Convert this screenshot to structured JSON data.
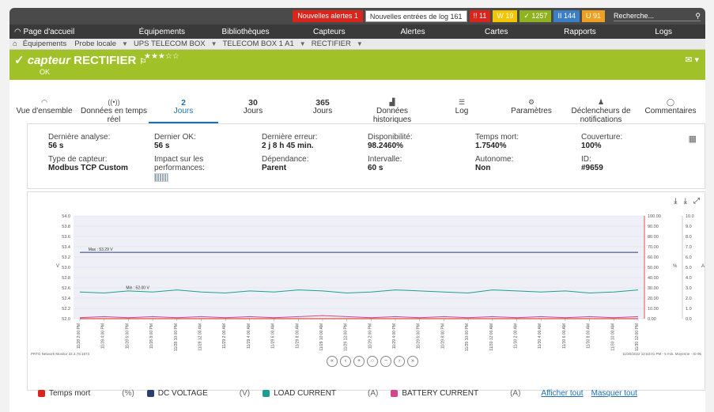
{
  "topbar": {
    "new_alerts_label": "Nouvelles alertes",
    "new_alerts_count": "1",
    "new_logs_label": "Nouvelles entrées de log",
    "new_logs_count": "161",
    "badges": [
      {
        "text": "!! 11",
        "color": "#d9251c"
      },
      {
        "text": "W 19",
        "color": "#f2c500"
      },
      {
        "text": "✓ 1257",
        "color": "#8fb31f"
      },
      {
        "text": "II 144",
        "color": "#3d7fc4"
      },
      {
        "text": "U 91",
        "color": "#f0a020"
      }
    ],
    "search_placeholder": "Recherche..."
  },
  "nav": [
    "Page d'accueil",
    "Équipements",
    "Bibliothèques",
    "Capteurs",
    "Alertes",
    "Cartes",
    "Rapports",
    "Logs"
  ],
  "breadcrumb": [
    "Équipements",
    "Probe locale",
    "UPS TELECOM BOX",
    "TELECOM BOX 1 A1",
    "RECTIFIER"
  ],
  "header": {
    "prefix": "capteur",
    "name": "RECTIFIER",
    "stars": "★★★☆☆",
    "status": "OK",
    "accent": "#a1c129"
  },
  "tabs": [
    {
      "icon": "◠",
      "num": "",
      "label": "Vue d'ensemble"
    },
    {
      "icon": "((•))",
      "num": "",
      "label": "Données en temps réel"
    },
    {
      "icon": "",
      "num": "2",
      "label": "Jours",
      "active": true
    },
    {
      "icon": "",
      "num": "30",
      "label": "Jours"
    },
    {
      "icon": "",
      "num": "365",
      "label": "Jours"
    },
    {
      "icon": "▟",
      "num": "",
      "label": "Données historiques"
    },
    {
      "icon": "☰",
      "num": "",
      "label": "Log"
    },
    {
      "icon": "⚙",
      "num": "",
      "label": "Paramètres"
    },
    {
      "icon": "♟",
      "num": "",
      "label": "Déclencheurs de notifications"
    },
    {
      "icon": "◯",
      "num": "",
      "label": "Commentaires"
    }
  ],
  "info": {
    "last_scan_label": "Dernière analyse:",
    "last_scan": "56 s",
    "last_ok_label": "Dernier OK:",
    "last_ok": "56 s",
    "last_error_label": "Dernière erreur:",
    "last_error": "2 j 8 h 45 min.",
    "availability_label": "Disponibilité:",
    "availability": "98.2460%",
    "downtime_label": "Temps mort:",
    "downtime": "1.7540%",
    "coverage_label": "Couverture:",
    "coverage": "100%",
    "type_label": "Type de capteur:",
    "type": "Modbus TCP Custom",
    "impact_label": "Impact sur les performances:",
    "dependency_label": "Dépendance:",
    "dependency": "Parent",
    "interval_label": "Intervalle:",
    "interval": "60 s",
    "autonomous_label": "Autonome:",
    "autonomous": "Non",
    "id_label": "ID:",
    "id": "#9659"
  },
  "chart_data": {
    "type": "line",
    "left_axis": {
      "label": "V",
      "ylim": [
        52.0,
        54.0
      ],
      "ticks": [
        "54.0",
        "53.8",
        "53.6",
        "53.4",
        "53.2",
        "53.0",
        "52.8",
        "52.6",
        "52.4",
        "52.2",
        "52.0"
      ]
    },
    "right_axis_pct": {
      "label": "%",
      "ylim": [
        0,
        100
      ],
      "ticks": [
        "100.00",
        "90.00",
        "80.00",
        "70.00",
        "60.00",
        "50.00",
        "40.00",
        "30.00",
        "20.00",
        "10.00",
        "0.00"
      ]
    },
    "right_axis_a": {
      "label": "A",
      "ylim": [
        0,
        10
      ],
      "ticks": [
        "10.0",
        "9.0",
        "8.0",
        "7.0",
        "6.0",
        "5.0",
        "4.0",
        "3.0",
        "2.0",
        "1.0",
        "0.0"
      ]
    },
    "x_ticks": [
      "11/28 2:00 PM",
      "11/28 4:00 PM",
      "11/28 6:00 PM",
      "11/28 8:00 PM",
      "11/28 10:00 PM",
      "11/29 12:00 AM",
      "11/29 2:00 AM",
      "11/29 4:00 AM",
      "11/29 6:00 AM",
      "11/29 8:00 AM",
      "11/29 10:00 AM",
      "11/29 12:00 PM",
      "11/29 2:00 PM",
      "11/29 4:00 PM",
      "11/29 6:00 PM",
      "11/29 8:00 PM",
      "11/29 10:00 PM",
      "11/30 12:00 AM",
      "11/30 2:00 AM",
      "11/30 4:00 AM",
      "11/30 6:00 AM",
      "11/30 8:00 AM",
      "11/30 10:00 AM",
      "11/30 12:00 PM"
    ],
    "annotations": [
      {
        "text": "Max : 53.29 V",
        "x_index": 0.35,
        "y": 53.29
      },
      {
        "text": "Min : 52.00 V",
        "x_index": 1.9,
        "y": 52.55
      }
    ],
    "series": [
      {
        "name": "DC VOLTAGE",
        "unit": "(V)",
        "color": "#2c3e70",
        "values": [
          53.29,
          53.29,
          53.29,
          53.29,
          53.29,
          53.29,
          53.29,
          53.29,
          53.29,
          53.29,
          53.29,
          53.29,
          53.29,
          53.29,
          53.29,
          53.29,
          53.29,
          53.29,
          53.29,
          53.29,
          53.29,
          53.29,
          53.29,
          53.29
        ]
      },
      {
        "name": "LOAD CURRENT",
        "unit": "(A)",
        "color": "#1e9e8e",
        "values": [
          2.6,
          2.5,
          2.7,
          2.6,
          2.8,
          2.6,
          2.5,
          2.7,
          2.6,
          2.8,
          2.7,
          2.5,
          2.6,
          2.8,
          2.7,
          2.6,
          2.5,
          2.8,
          2.7,
          2.6,
          2.7,
          2.5,
          2.6,
          2.8
        ]
      },
      {
        "name": "BATTERY CURRENT",
        "unit": "(A)",
        "color": "#d4458c",
        "values": [
          0.1,
          0.2,
          0.1,
          0.2,
          0.1,
          0.2,
          0.1,
          0.2,
          0.1,
          0.2,
          0.3,
          0.2,
          0.1,
          0.2,
          0.1,
          0.2,
          0.1,
          0.2,
          0.1,
          0.2,
          0.1,
          0.2,
          0.1,
          0.2
        ]
      },
      {
        "name": "Temps mort",
        "unit": "(%)",
        "color": "#d9251c",
        "values": [
          0,
          0,
          0,
          0,
          0,
          0,
          0,
          0,
          0,
          0,
          0,
          0,
          0,
          0,
          0,
          0,
          0,
          0,
          0,
          0,
          0,
          0,
          0,
          0
        ]
      }
    ],
    "footer_left": "PRTG Network Monitor 22.3.78.1873",
    "footer_right": "11/30/2022 12:53:01 PM - 5 min. Moyenne - ID 96"
  },
  "legend": {
    "show_all": "Afficher tout",
    "hide_all": "Masquer tout"
  }
}
